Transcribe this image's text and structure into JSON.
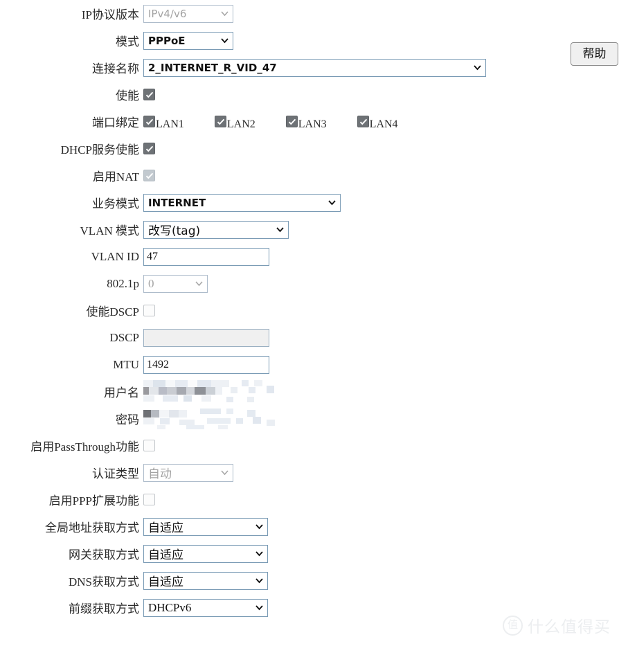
{
  "help": {
    "label": "帮助"
  },
  "watermark": {
    "badge": "值",
    "text": "什么值得买"
  },
  "rows": {
    "ip_version": {
      "label": "IP协议版本",
      "value": "IPv4/v6"
    },
    "mode": {
      "label": "模式",
      "value": "PPPoE"
    },
    "conn_name": {
      "label": "连接名称",
      "value": "2_INTERNET_R_VID_47"
    },
    "enable": {
      "label": "使能",
      "value": "checked"
    },
    "port_binding": {
      "label": "端口绑定"
    },
    "dhcp_enable": {
      "label": "DHCP服务使能",
      "value": "checked"
    },
    "nat_enable": {
      "label": "启用NAT",
      "value": "checked"
    },
    "service_mode": {
      "label": "业务模式",
      "value": "INTERNET"
    },
    "vlan_mode": {
      "label": "VLAN 模式",
      "value": "改写(tag)"
    },
    "vlan_id": {
      "label": "VLAN ID",
      "value": "47"
    },
    "p8021p": {
      "label": "802.1p",
      "value": "0"
    },
    "dscp_enable": {
      "label": "使能DSCP",
      "value": "unchecked"
    },
    "dscp": {
      "label": "DSCP",
      "value": ""
    },
    "mtu": {
      "label": "MTU",
      "value": "1492"
    },
    "username": {
      "label": "用户名",
      "value": ""
    },
    "password": {
      "label": "密码",
      "value": ""
    },
    "passthrough": {
      "label": "启用PassThrough功能",
      "value": "unchecked"
    },
    "auth_type": {
      "label": "认证类型",
      "value": "自动"
    },
    "ppp_ext": {
      "label": "启用PPP扩展功能",
      "value": "unchecked"
    },
    "global_addr_mode": {
      "label": "全局地址获取方式",
      "value": "自适应"
    },
    "gateway_mode": {
      "label": "网关获取方式",
      "value": "自适应"
    },
    "dns_mode": {
      "label": "DNS获取方式",
      "value": "自适应"
    },
    "prefix_mode": {
      "label": "前缀获取方式",
      "value": "DHCPv6"
    }
  },
  "lan_ports": [
    {
      "label": "LAN1",
      "state": "checked"
    },
    {
      "label": "LAN2",
      "state": "checked"
    },
    {
      "label": "LAN3",
      "state": "checked"
    },
    {
      "label": "LAN4",
      "state": "checked"
    }
  ],
  "icons": {
    "chevron": "chevron-down-icon",
    "check": "check-mark-icon"
  },
  "colors": {
    "field_border": "#7a9bb5",
    "label_text": "#2b2b2b",
    "checkbox_checked": "#6e7276",
    "checkbox_dim": "#c2c9cf",
    "disabled_input_bg": "#f0f0f0",
    "help_button_bg": "#f0f0f0",
    "watermark": "#eceef0"
  },
  "censored": {
    "username_note": "mosaic",
    "password_note": "mosaic"
  }
}
